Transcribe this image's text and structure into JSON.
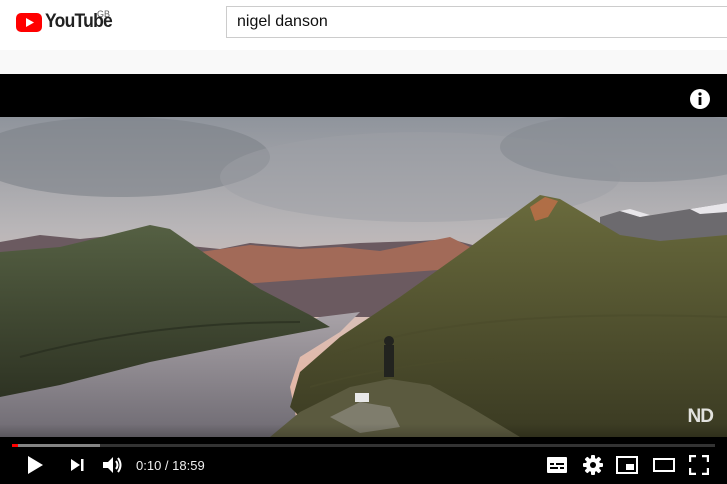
{
  "masthead": {
    "logo_text": "YouTube",
    "region": "GB",
    "search": {
      "value": "nigel danson"
    }
  },
  "player": {
    "watermark": "ND",
    "time": {
      "current": "0:10",
      "separator": " / ",
      "duration": "18:59"
    },
    "progress": {
      "played_fraction": 0.009,
      "buffered_fraction": 0.125
    },
    "icons": {
      "info": "info-icon",
      "play": "play-icon",
      "next": "next-icon",
      "volume": "volume-icon",
      "subtitles": "subtitles-icon",
      "settings": "gear-icon",
      "miniplayer": "miniplayer-icon",
      "theater": "theater-mode-icon",
      "fullscreen": "fullscreen-icon"
    }
  },
  "colors": {
    "brand_red": "#ff0000",
    "progress_red": "#ff0000"
  }
}
